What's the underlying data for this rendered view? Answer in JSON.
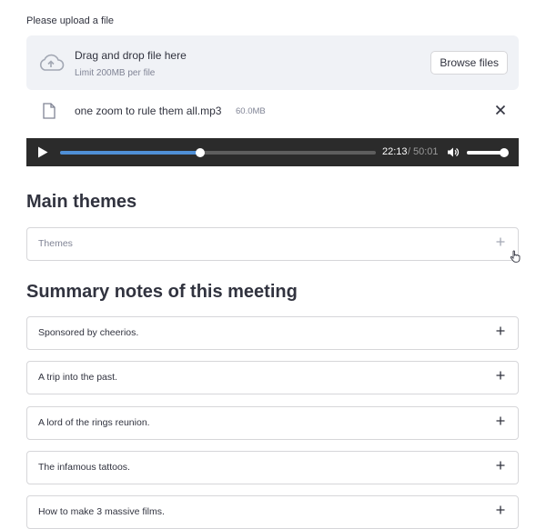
{
  "uploader": {
    "label": "Please upload a file",
    "dropzone_title": "Drag and drop file here",
    "dropzone_limit": "Limit 200MB per file",
    "browse_label": "Browse files"
  },
  "file": {
    "name": "one zoom to rule them all.mp3",
    "size": "60.0MB"
  },
  "player": {
    "current_time": "22:13",
    "separator": "/",
    "total_time": "50:01",
    "progress_fraction": 0.444,
    "volume_fraction": 0.9
  },
  "themes_section": {
    "title": "Main themes",
    "expander_label": "Themes"
  },
  "summary_section": {
    "title": "Summary notes of this meeting",
    "items": [
      {
        "label": "Sponsored by cheerios."
      },
      {
        "label": "A trip into the past."
      },
      {
        "label": "A lord of the rings reunion."
      },
      {
        "label": "The infamous tattoos."
      },
      {
        "label": "How to make 3 massive films."
      }
    ]
  },
  "icons": {
    "upload": "cloud-upload-icon",
    "file": "file-icon",
    "remove": "close-icon",
    "play": "play-icon",
    "volume": "volume-icon",
    "expand": "plus-icon",
    "pointer": "hand-pointer-icon"
  },
  "colors": {
    "dropzone_bg": "#f0f2f6",
    "player_bg": "#2b2b2b",
    "seek_fill": "#4f8fd6",
    "text": "#31333f",
    "muted": "#808495",
    "border": "#d6d6d9"
  }
}
